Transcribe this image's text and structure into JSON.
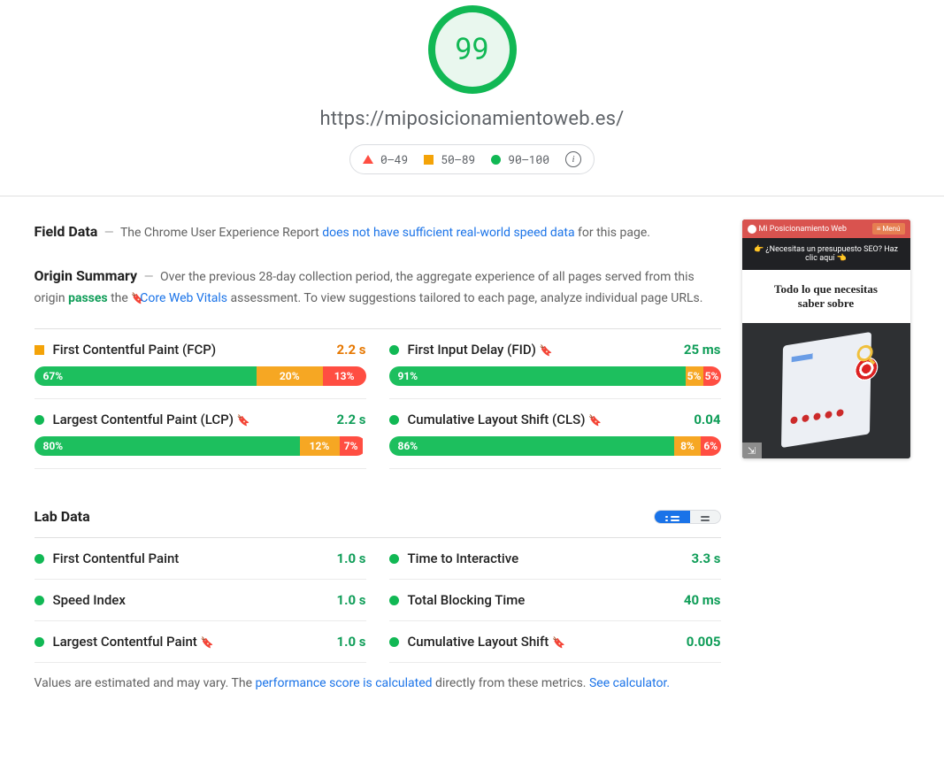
{
  "header": {
    "score": "99",
    "url": "https://miposicionamientoweb.es/",
    "legend": {
      "red": "0–49",
      "orange": "50–89",
      "green": "90–100"
    }
  },
  "field_data": {
    "title": "Field Data",
    "text1": "The Chrome User Experience Report ",
    "link": "does not have sufficient real-world speed data",
    "text2": " for this page."
  },
  "origin_summary": {
    "title": "Origin Summary",
    "text1": "Over the previous 28-day collection period, the aggregate experience of all pages served from this origin ",
    "passes": "passes",
    "text2": " the ",
    "cwv_link": "Core Web Vitals",
    "text3": " assessment. To view suggestions tailored to each page, analyze individual page URLs."
  },
  "field_metrics": [
    {
      "dot": "orange",
      "name": "First Contentful Paint (FCP)",
      "bookmark": false,
      "val": "2.2 s",
      "val_class": "orange",
      "bar": {
        "g": "67%",
        "o": "20%",
        "r": "13%"
      }
    },
    {
      "dot": "green",
      "name": "First Input Delay (FID)",
      "bookmark": true,
      "val": "25 ms",
      "val_class": "green",
      "bar": {
        "g": "91%",
        "o": "5%",
        "r": "5%"
      }
    },
    {
      "dot": "green",
      "name": "Largest Contentful Paint (LCP)",
      "bookmark": true,
      "val": "2.2 s",
      "val_class": "green",
      "bar": {
        "g": "80%",
        "o": "12%",
        "r": "7%"
      }
    },
    {
      "dot": "green",
      "name": "Cumulative Layout Shift (CLS)",
      "bookmark": true,
      "val": "0.04",
      "val_class": "green",
      "bar": {
        "g": "86%",
        "o": "8%",
        "r": "6%"
      }
    }
  ],
  "lab": {
    "title": "Lab Data",
    "metrics": [
      {
        "name": "First Contentful Paint",
        "bookmark": false,
        "val": "1.0 s"
      },
      {
        "name": "Time to Interactive",
        "bookmark": false,
        "val": "3.3 s"
      },
      {
        "name": "Speed Index",
        "bookmark": false,
        "val": "1.0 s"
      },
      {
        "name": "Total Blocking Time",
        "bookmark": false,
        "val": "40 ms"
      },
      {
        "name": "Largest Contentful Paint",
        "bookmark": true,
        "val": "1.0 s"
      },
      {
        "name": "Cumulative Layout Shift",
        "bookmark": true,
        "val": "0.005"
      }
    ],
    "footer1": "Values are estimated and may vary. The ",
    "footer_link1": "performance score is calculated",
    "footer2": " directly from these metrics. ",
    "footer_link2": "See calculator."
  },
  "thumbnail": {
    "brand": "Mi Posicionamiento Web",
    "menu": "≡ Menú",
    "banner": "👉 ¿Necesitas un presupuesto SEO? Haz clic aquí 👈",
    "title1": "Todo lo que necesitas",
    "title2": "saber sobre"
  }
}
